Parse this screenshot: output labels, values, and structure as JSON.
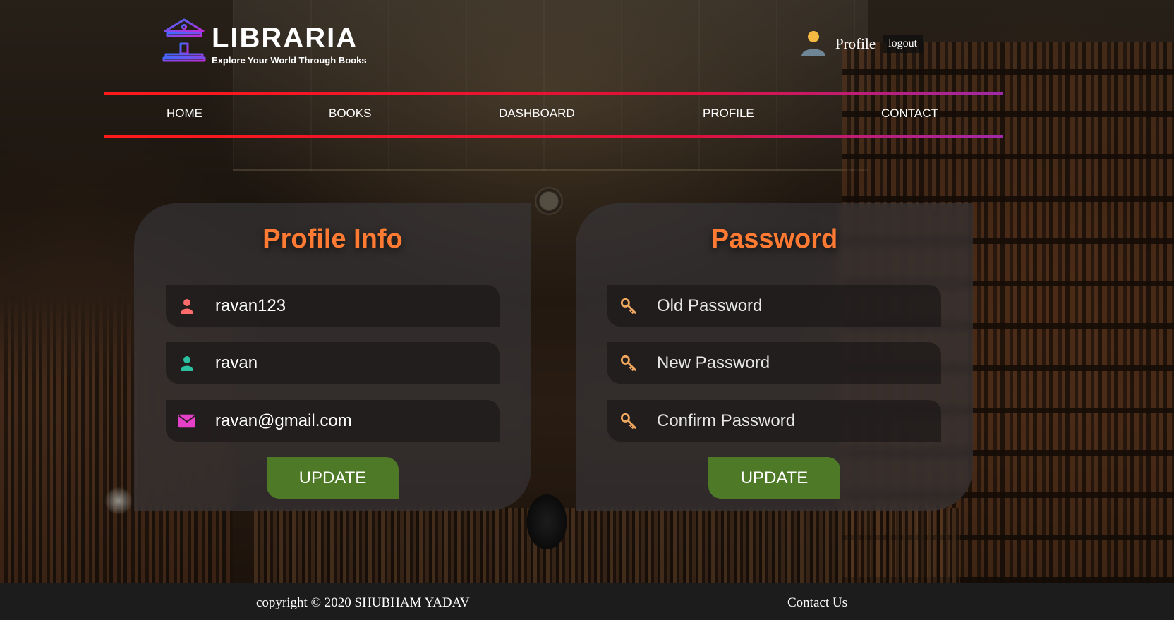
{
  "brand": {
    "title": "LIBRARIA",
    "tagline": "Explore Your World Through Books",
    "logo_icon": "library-building-icon"
  },
  "user": {
    "profile_label": "Profile",
    "logout_label": "logout",
    "avatar_icon": "user-avatar-icon"
  },
  "nav": {
    "items": [
      {
        "label": "HOME"
      },
      {
        "label": "BOOKS"
      },
      {
        "label": "DASHBOARD"
      },
      {
        "label": "PROFILE"
      },
      {
        "label": "CONTACT"
      }
    ]
  },
  "profile_info": {
    "title": "Profile Info",
    "fields": [
      {
        "value": "ravan123",
        "icon": "user-icon",
        "icon_color": "#ff6b6b"
      },
      {
        "value": "ravan",
        "icon": "user-icon",
        "icon_color": "#2bc0a0"
      },
      {
        "value": "ravan@gmail.com",
        "icon": "envelope-icon",
        "icon_color": "#e640c8"
      }
    ],
    "button_label": "UPDATE"
  },
  "password": {
    "title": "Password",
    "fields": [
      {
        "placeholder": "Old Password",
        "icon": "key-icon"
      },
      {
        "placeholder": "New Password",
        "icon": "key-icon"
      },
      {
        "placeholder": "Confirm Password",
        "icon": "key-icon"
      }
    ],
    "icon_color": "#f0a860",
    "button_label": "UPDATE"
  },
  "footer": {
    "copyright": "copyright © 2020 SHUBHAM YADAV",
    "contact_label": "Contact Us"
  },
  "colors": {
    "accent_title": "#ff7a33",
    "button_bg": "#4e7a27",
    "nav_line_start": "#ff1a1a",
    "nav_line_end": "#a12aa8"
  }
}
